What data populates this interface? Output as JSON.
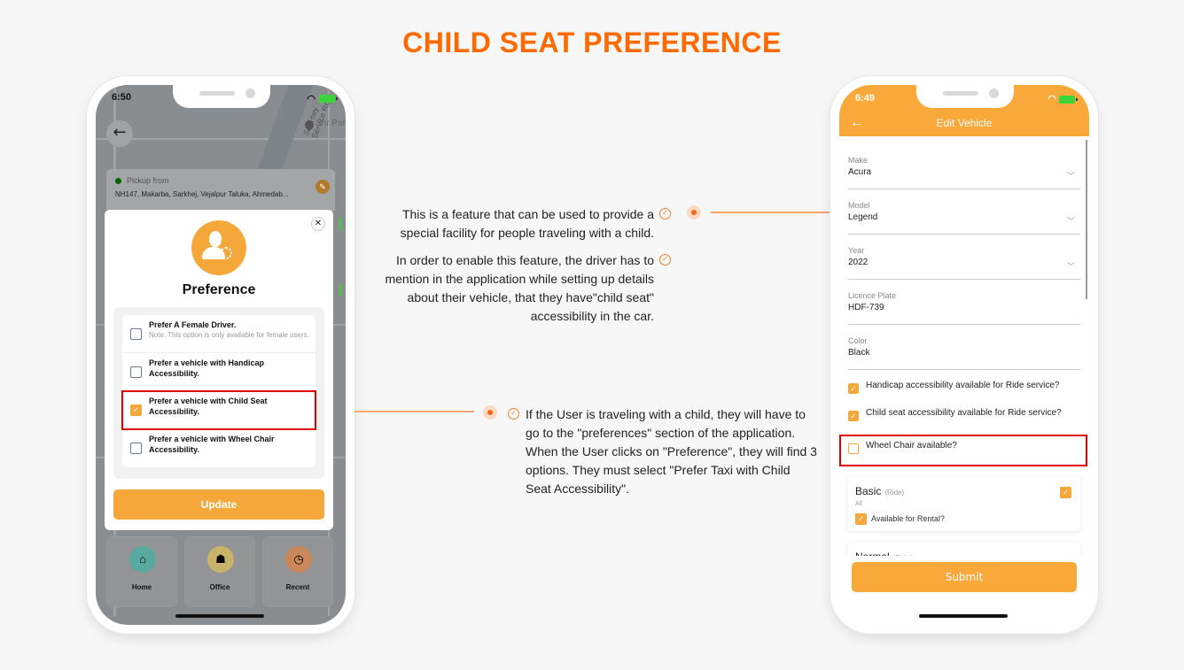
{
  "title": "CHILD SEAT PREFERENCE",
  "annotations": [
    {
      "text": "This is a feature that can be used to provide a special facility for people traveling with a child."
    },
    {
      "text": "In order to enable this feature, the driver has to mention in the application while setting up details about their vehicle, that they have\"child seat\" accessibility in the car."
    },
    {
      "text": "If the User is traveling with a child, they will have to go to the \"preferences\" section of the application. When the User clicks on \"Preference\", they will find 3 options. They must select \"Prefer Taxi with Child Seat Accessibility\"."
    }
  ],
  "left_phone": {
    "status_time": "6:50",
    "map_label": "SG Hwy Service Rd",
    "map_place": "Shr Pat",
    "pickup_label": "Pickup from",
    "pickup_address": "NH147, Makarba, Sarkhej, Vejalpur Taluka, Ahmedab...",
    "modal": {
      "title": "Preference",
      "options": [
        {
          "label": "Prefer A Female Driver.",
          "note": "Note: This option is only available for female users.",
          "checked": false
        },
        {
          "label": "Prefer a vehicle with Handicap Accessibility.",
          "checked": false
        },
        {
          "label": "Prefer a vehicle with Child Seat Accessibility.",
          "checked": true
        },
        {
          "label": "Prefer a vehicle with Wheel Chair Accessibility.",
          "checked": false
        }
      ],
      "update_label": "Update"
    },
    "quick_actions": [
      {
        "label": "Home",
        "icon": "home-icon",
        "color": "#5aa9a0"
      },
      {
        "label": "Office",
        "icon": "office-icon",
        "color": "#c9b36a"
      },
      {
        "label": "Recent",
        "icon": "recent-icon",
        "color": "#c9875a"
      }
    ]
  },
  "right_phone": {
    "status_time": "6:49",
    "title": "Edit Vehicle",
    "fields": [
      {
        "label": "Make",
        "value": "Acura",
        "dropdown": true
      },
      {
        "label": "Model",
        "value": "Legend",
        "dropdown": true
      },
      {
        "label": "Year",
        "value": "2022",
        "dropdown": true
      },
      {
        "label": "Licence Plate",
        "value": "HDF-739",
        "dropdown": false
      },
      {
        "label": "Color",
        "value": "Black",
        "dropdown": false
      }
    ],
    "checks": [
      {
        "label": "Handicap accessibility available for Ride service?",
        "checked": true
      },
      {
        "label": "Child seat accessibility available for Ride service?",
        "checked": true
      },
      {
        "label": "Wheel Chair available?",
        "checked": false
      }
    ],
    "service_types": [
      {
        "name": "Basic",
        "tag": "(Ride)",
        "sub": "All",
        "checked": true,
        "rental_label": "Available for Rental?",
        "rental_checked": true
      },
      {
        "name": "Normal",
        "tag": "(Ride)",
        "checked": true
      }
    ],
    "submit_label": "Submit"
  },
  "colors": {
    "accent": "#f9a83a",
    "title": "#ff6a00",
    "highlight": "#e00000"
  }
}
